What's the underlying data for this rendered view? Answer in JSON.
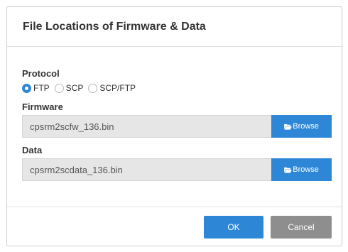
{
  "dialog": {
    "title": "File Locations of Firmware & Data"
  },
  "protocol": {
    "label": "Protocol",
    "options": [
      "FTP",
      "SCP",
      "SCP/FTP"
    ],
    "selected": "FTP"
  },
  "firmware": {
    "label": "Firmware",
    "value": "cpsrm2scfw_136.bin",
    "browse_label": "Browse"
  },
  "data_file": {
    "label": "Data",
    "value": "cpsrm2scdata_136.bin",
    "browse_label": "Browse"
  },
  "footer": {
    "ok_label": "OK",
    "cancel_label": "Cancel"
  },
  "colors": {
    "accent": "#2d87d6",
    "cancel": "#8e8e8e",
    "input_bg": "#e6e6e6"
  }
}
